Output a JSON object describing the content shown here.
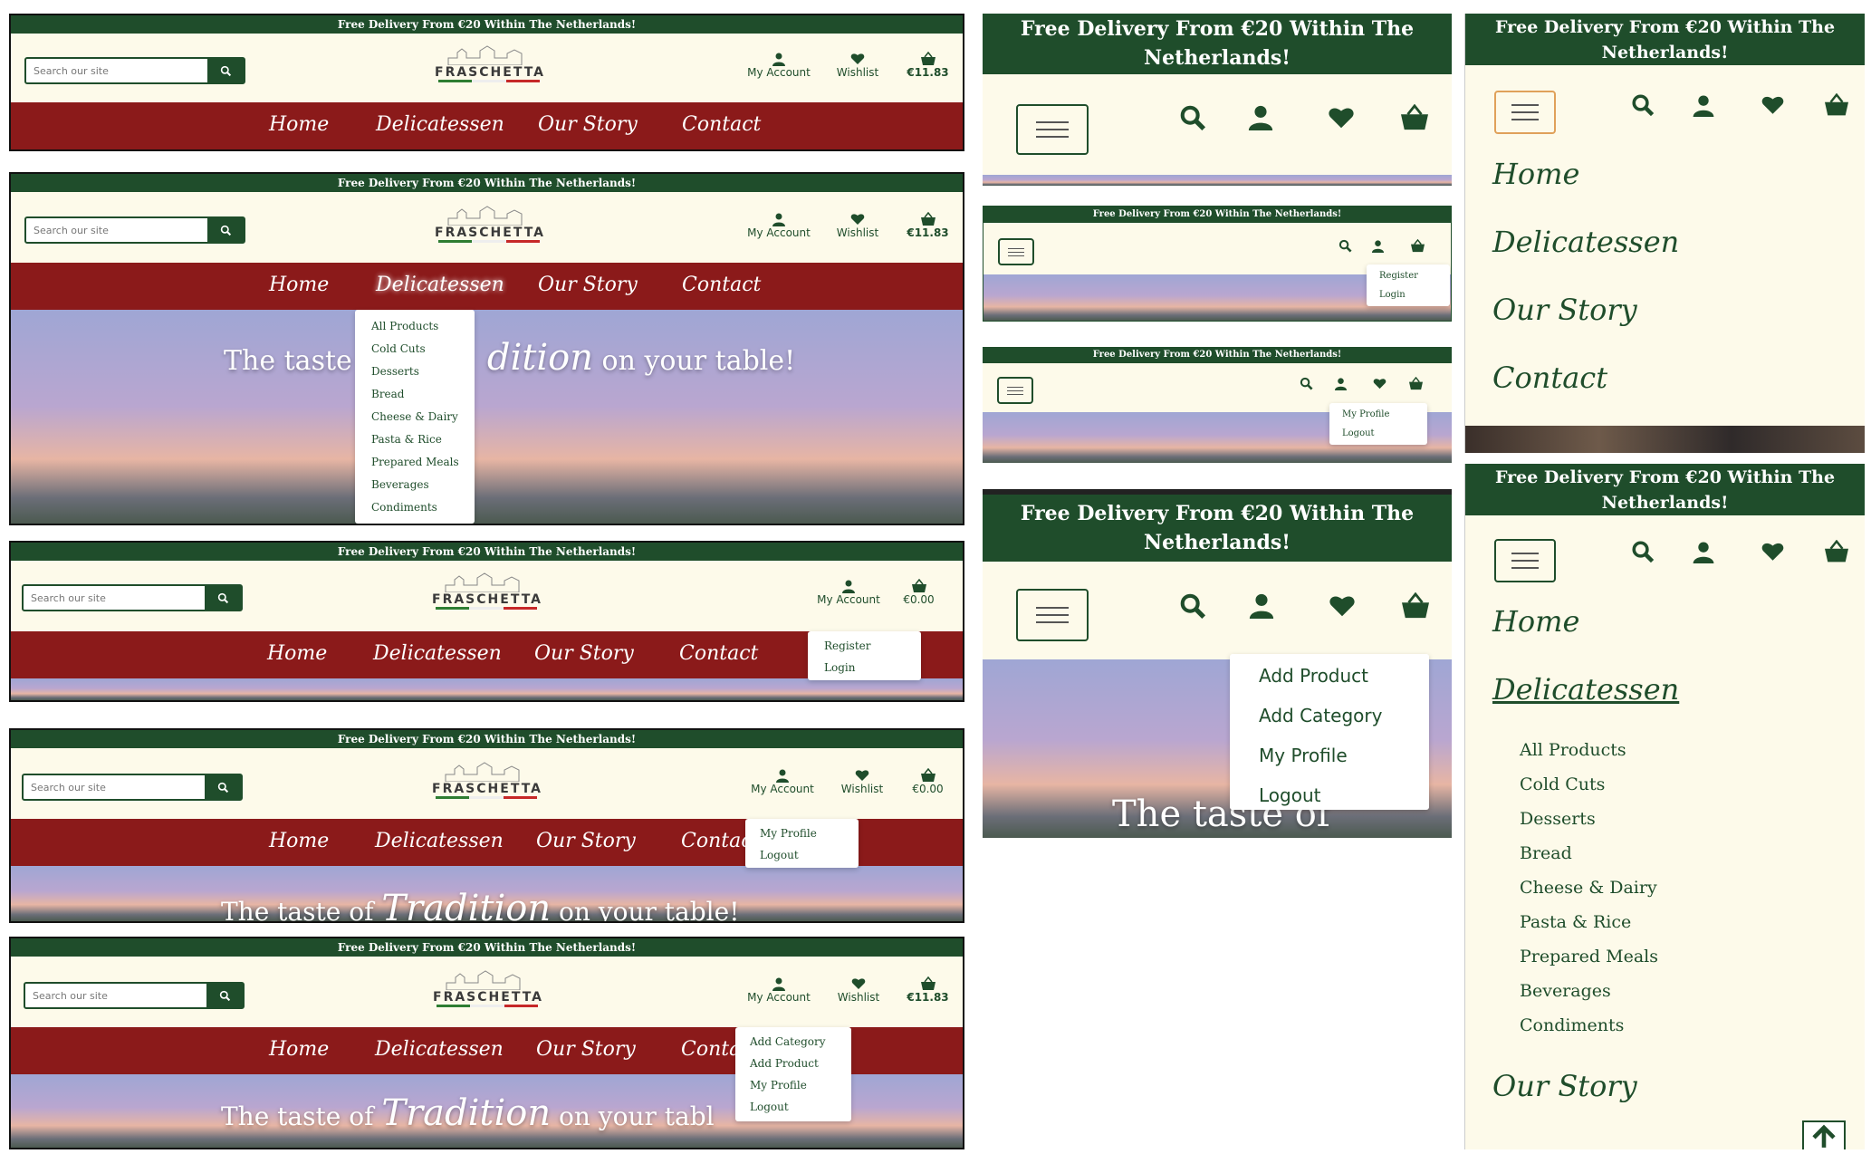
{
  "banner_text": "Free Delivery From €20 Within The Netherlands!",
  "search_placeholder": "Search our site",
  "logo": {
    "prefix": "la",
    "name": "FRASCHETTA"
  },
  "header": {
    "account_label": "My Account",
    "wishlist_label": "Wishlist",
    "basket_full": "€11.83",
    "basket_empty": "€0.00"
  },
  "nav": {
    "home": "Home",
    "delicatessen": "Delicatessen",
    "our_story": "Our Story",
    "contact": "Contact",
    "contact_partial": "Contac"
  },
  "hero": {
    "pre": "The taste of",
    "script": "Tradition",
    "post": "on your table!",
    "pre_short": "The taste",
    "script_partial": "dition",
    "post_clipped": "on your tabl",
    "post_clipped2": "on your table!",
    "mobile_clip": "The taste of"
  },
  "delicatessen_menu": [
    "All Products",
    "Cold Cuts",
    "Desserts",
    "Bread",
    "Cheese & Dairy",
    "Pasta & Rice",
    "Prepared Meals",
    "Beverages",
    "Condiments"
  ],
  "guest_menu": [
    "Register",
    "Login"
  ],
  "user_menu": [
    "My Profile",
    "Logout"
  ],
  "admin_menu": [
    "Add Category",
    "Add Product",
    "My Profile",
    "Logout"
  ],
  "admin_menu_mobile": [
    "Add Product",
    "Add Category",
    "My Profile",
    "Logout"
  ],
  "mobile_banner_line1": "Free Delivery From €20 Within The",
  "mobile_banner_line2": "Netherlands!",
  "colors": {
    "green": "#1f4d2b",
    "red": "#8b1a1a",
    "cream": "#fdfaea"
  }
}
